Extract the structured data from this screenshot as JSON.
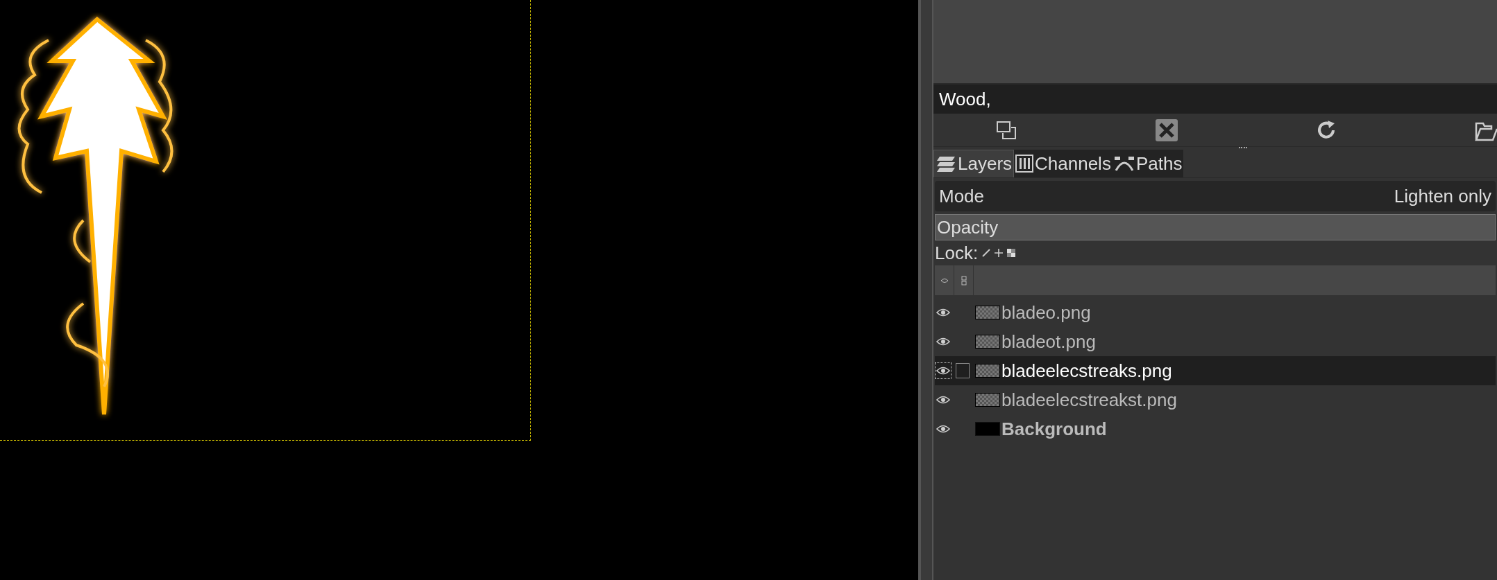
{
  "tags_field": {
    "value": "Wood,"
  },
  "tabs": [
    {
      "label": "Layers",
      "selected": true
    },
    {
      "label": "Channels",
      "selected": false
    },
    {
      "label": "Paths",
      "selected": false
    }
  ],
  "mode": {
    "label": "Mode",
    "value": "Lighten only"
  },
  "opacity": {
    "label": "Opacity",
    "level": 1
  },
  "lock": {
    "label": "Lock:"
  },
  "layers": [
    {
      "name": "bladeo.png",
      "visible": true,
      "selected": false,
      "kind": "alpha"
    },
    {
      "name": "bladeot.png",
      "visible": true,
      "selected": false,
      "kind": "alpha"
    },
    {
      "name": "bladeelecstreaks.png",
      "visible": true,
      "selected": true,
      "kind": "alpha"
    },
    {
      "name": "bladeelecstreakst.png",
      "visible": true,
      "selected": false,
      "kind": "alpha"
    },
    {
      "name": "Background",
      "visible": true,
      "selected": false,
      "kind": "background"
    }
  ]
}
